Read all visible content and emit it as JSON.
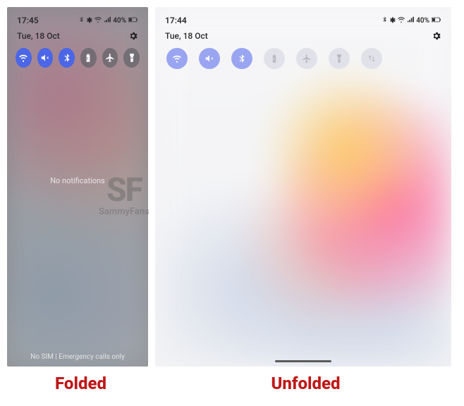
{
  "folded": {
    "time": "17:45",
    "date": "Tue, 18 Oct",
    "battery_text": "40%",
    "no_notifications": "No notifications",
    "bottom_status": "No SIM | Emergency calls only",
    "quick_settings": [
      {
        "name": "wifi",
        "active": true
      },
      {
        "name": "mute",
        "active": true
      },
      {
        "name": "bluetooth",
        "active": true
      },
      {
        "name": "battery-saver",
        "active": false
      },
      {
        "name": "airplane",
        "active": false
      },
      {
        "name": "flashlight",
        "active": false
      }
    ]
  },
  "unfolded": {
    "time": "17:44",
    "date": "Tue, 18 Oct",
    "battery_text": "40%",
    "quick_settings": [
      {
        "name": "wifi",
        "active": true
      },
      {
        "name": "mute",
        "active": true
      },
      {
        "name": "bluetooth",
        "active": true
      },
      {
        "name": "battery-saver",
        "active": false
      },
      {
        "name": "airplane",
        "active": false
      },
      {
        "name": "flashlight",
        "active": false
      },
      {
        "name": "data-transfer",
        "active": false
      }
    ]
  },
  "labels": {
    "folded": "Folded",
    "unfolded": "Unfolded"
  },
  "watermark": {
    "logo": "SF",
    "text": "SammyFans"
  }
}
